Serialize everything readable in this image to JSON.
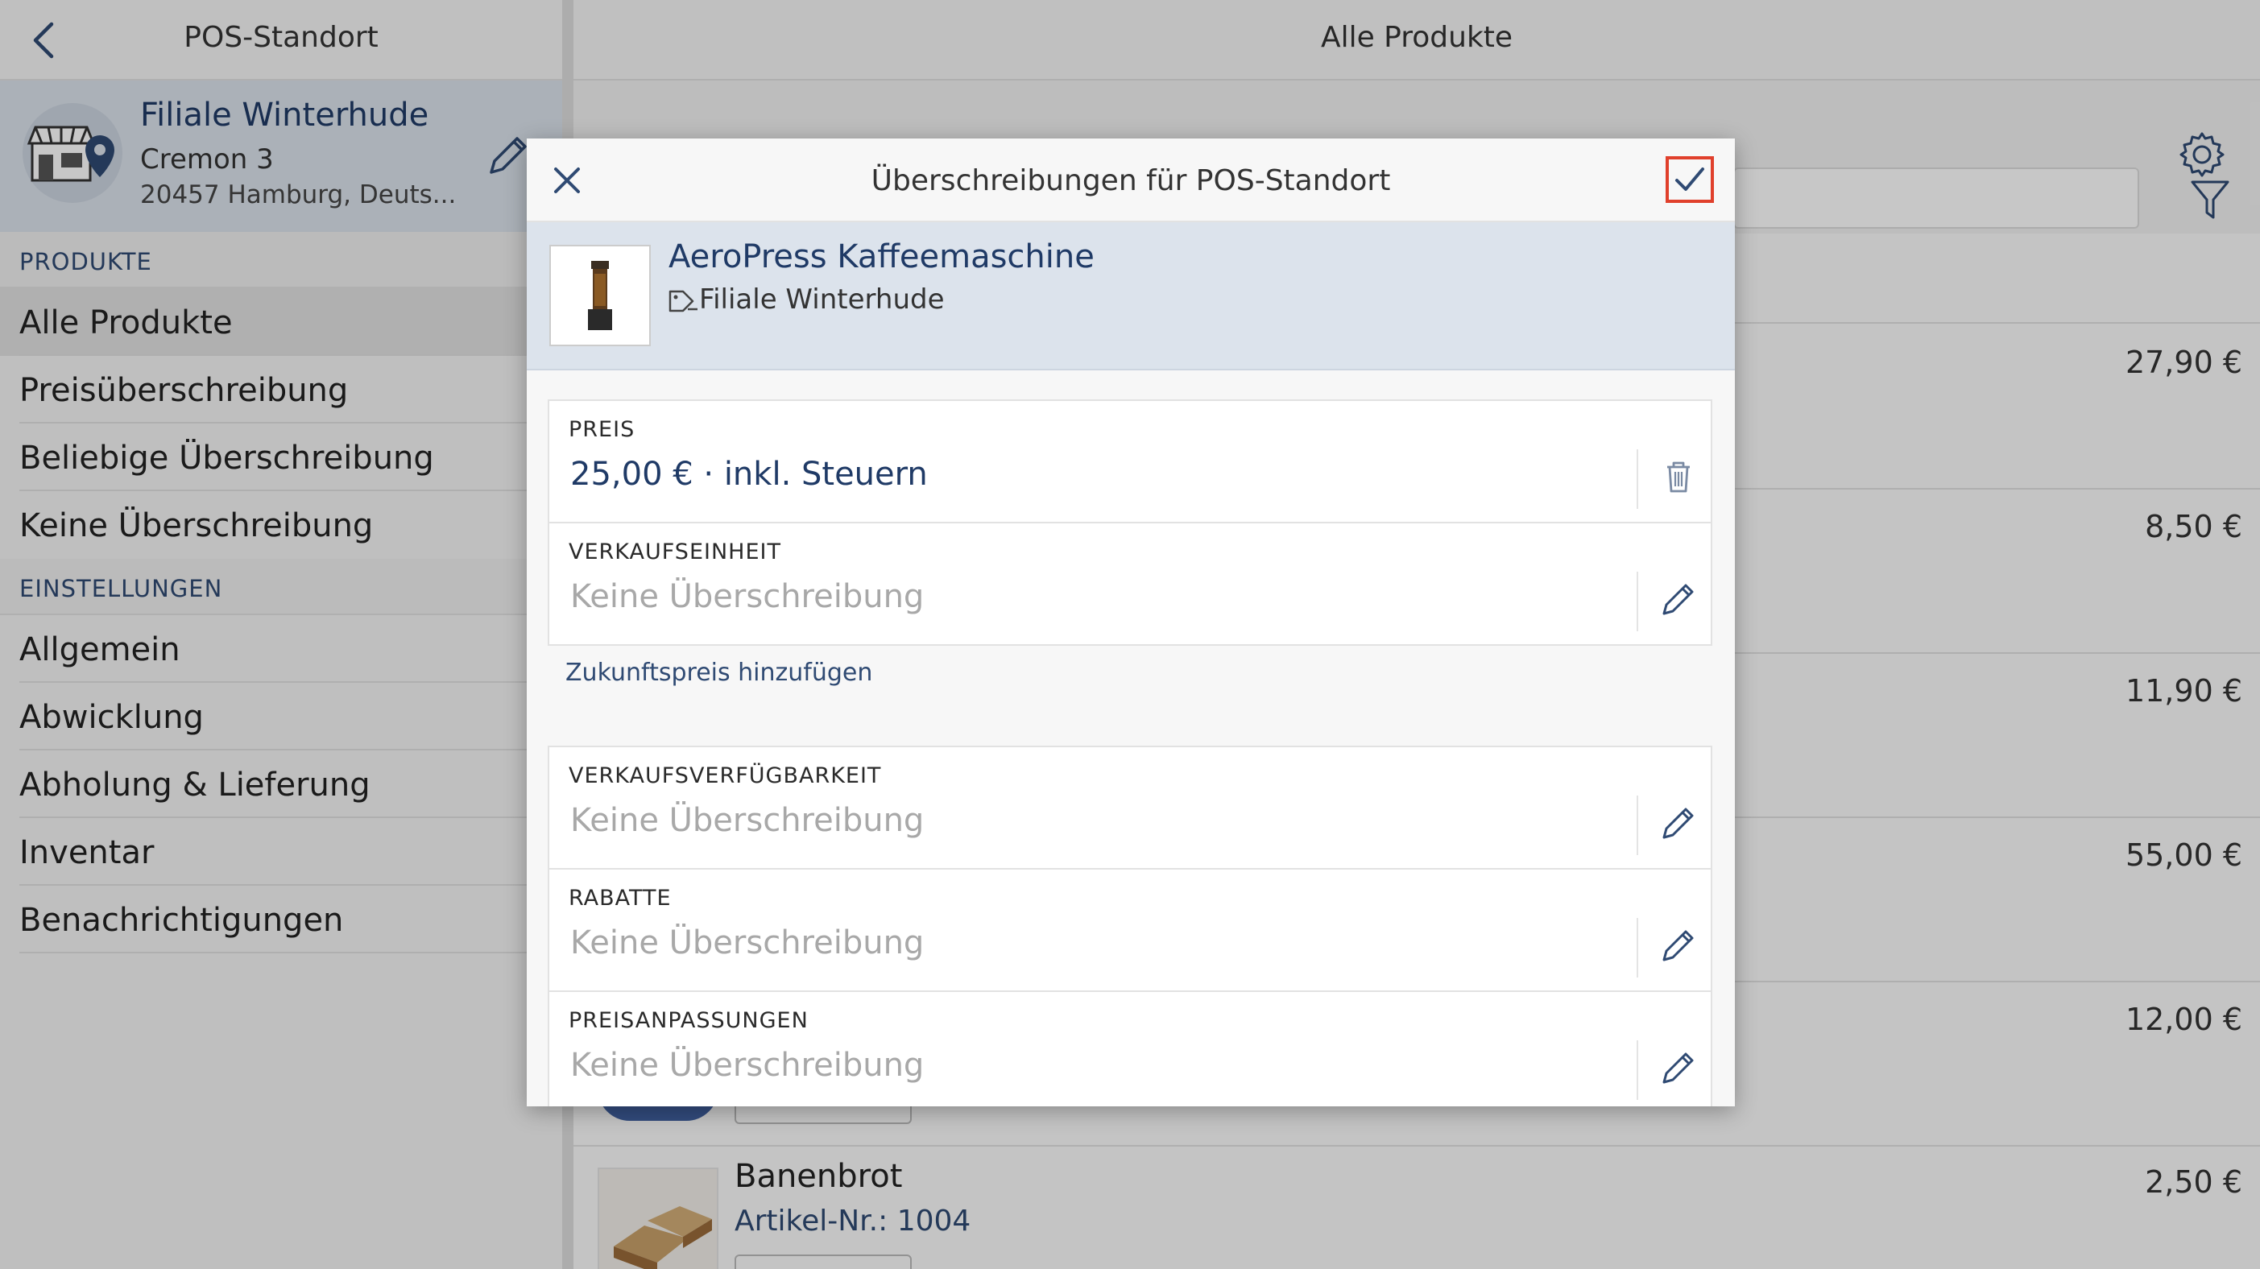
{
  "sidebar": {
    "title": "POS-Standort",
    "location": {
      "name": "Filiale Winterhude",
      "street": "Cremon 3",
      "city": "20457 Hamburg, Deuts..."
    },
    "sections": [
      {
        "label": "PRODUKTE"
      },
      {
        "label": "EINSTELLUNGEN"
      }
    ],
    "products_items": [
      {
        "label": "Alle Produkte"
      },
      {
        "label": "Preisüberschreibung"
      },
      {
        "label": "Beliebige Überschreibung"
      },
      {
        "label": "Keine Überschreibung"
      }
    ],
    "settings_items": [
      {
        "label": "Allgemein"
      },
      {
        "label": "Abwicklung"
      },
      {
        "label": "Abholung & Lieferung"
      },
      {
        "label": "Inventar"
      },
      {
        "label": "Benachrichtigungen"
      }
    ]
  },
  "main": {
    "title": "Alle Produkte",
    "prices": [
      "27,90 €",
      "8,50 €",
      "11,90 €",
      "55,00 €",
      "12,00 €",
      "2,50 €"
    ],
    "last_product": {
      "name": "Banenbrot",
      "sku": "Artikel-Nr.: 1004"
    }
  },
  "modal": {
    "title": "Überschreibungen für POS-Standort",
    "product": {
      "name": "AeroPress Kaffeemaschine",
      "location": "Filiale Winterhude"
    },
    "fields": [
      {
        "label": "PREIS",
        "value": "25,00 € · inkl. Steuern",
        "icon": "trash-icon"
      },
      {
        "label": "VERKAUFSEINHEIT",
        "value": "Keine Überschreibung",
        "icon": "pencil-icon"
      },
      {
        "label": "VERKAUFSVERFÜGBARKEIT",
        "value": "Keine Überschreibung",
        "icon": "pencil-icon"
      },
      {
        "label": "RABATTE",
        "value": "Keine Überschreibung",
        "icon": "pencil-icon"
      },
      {
        "label": "PREISANPASSUNGEN",
        "value": "Keine Überschreibung",
        "icon": "pencil-icon"
      }
    ],
    "future_price_link": "Zukunftspreis hinzufügen"
  },
  "colors": {
    "brand_navy": "#1f3a66",
    "confirm_highlight": "#e0402c",
    "header_tint": "#dce3ec"
  }
}
